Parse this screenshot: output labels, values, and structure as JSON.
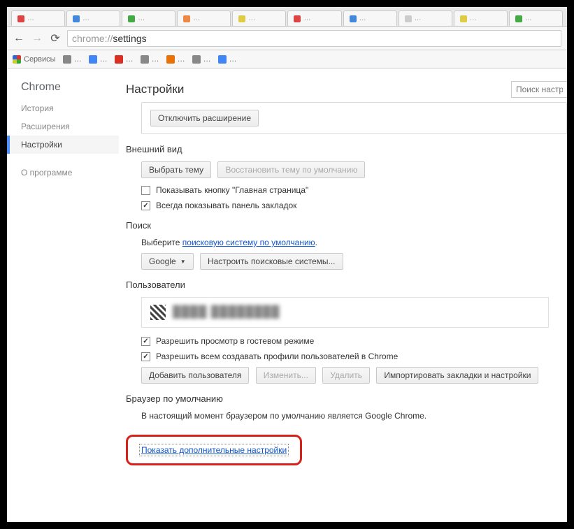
{
  "tabs": [
    {
      "label": "…"
    },
    {
      "label": "…"
    },
    {
      "label": "…"
    },
    {
      "label": "…"
    },
    {
      "label": "…"
    },
    {
      "label": "…"
    },
    {
      "label": "…"
    },
    {
      "label": "…"
    },
    {
      "label": "…"
    },
    {
      "label": "…"
    }
  ],
  "url": {
    "protocol": "chrome://",
    "path": "settings"
  },
  "bookmarks": {
    "apps_label": "Сервисы",
    "items": [
      {
        "label": "…"
      },
      {
        "label": "…"
      },
      {
        "label": "…"
      },
      {
        "label": "…"
      },
      {
        "label": "…"
      },
      {
        "label": "…"
      },
      {
        "label": "…"
      }
    ]
  },
  "sidebar": {
    "brand": "Chrome",
    "items": [
      {
        "label": "История",
        "id": "history"
      },
      {
        "label": "Расширения",
        "id": "extensions"
      },
      {
        "label": "Настройки",
        "id": "settings",
        "active": true
      }
    ],
    "about": "О программе"
  },
  "header": {
    "title": "Настройки",
    "search_placeholder": "Поиск настро"
  },
  "ext_section": {
    "disable_btn": "Отключить расширение"
  },
  "appearance": {
    "title": "Внешний вид",
    "choose_theme": "Выбрать тему",
    "reset_theme": "Восстановить тему по умолчанию",
    "show_home": "Показывать кнопку \"Главная страница\"",
    "show_bookmarks": "Всегда показывать панель закладок"
  },
  "search": {
    "title": "Поиск",
    "desc_prefix": "Выберите ",
    "desc_link": "поисковую систему по умолчанию",
    "desc_suffix": ".",
    "engine": "Google",
    "manage": "Настроить поисковые системы..."
  },
  "users": {
    "title": "Пользователи",
    "current_user": "████ ████████",
    "allow_guest": "Разрешить просмотр в гостевом режиме",
    "allow_create": "Разрешить всем создавать профили пользователей в Chrome",
    "add_user": "Добавить пользователя",
    "edit": "Изменить...",
    "delete": "Удалить",
    "import": "Импортировать закладки и настройки"
  },
  "default_browser": {
    "title": "Браузер по умолчанию",
    "text": "В настоящий момент браузером по умолчанию является Google Chrome."
  },
  "advanced": {
    "link": "Показать дополнительные настройки"
  }
}
